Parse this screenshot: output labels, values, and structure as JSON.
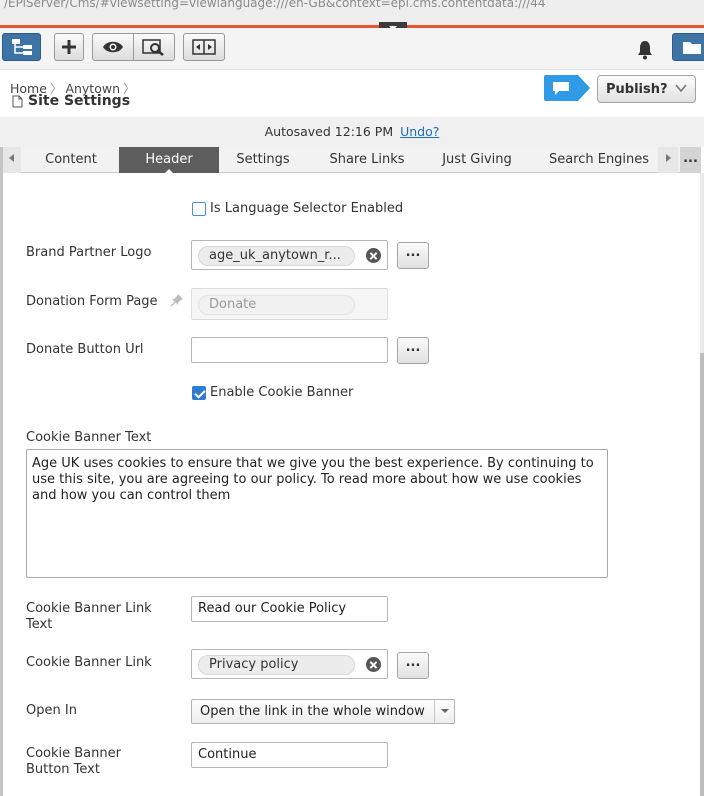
{
  "browser": {
    "url": "/EPiServer/Cms/#viewsetting=viewlanguage:///en-GB&context=epi.cms.contentdata:///44"
  },
  "toolbar": {
    "tree_icon": "page-tree-icon",
    "add_icon": "plus-icon",
    "preview_icon": "eye-icon",
    "view_icon": "view-settings-icon",
    "compare_icon": "compare-icon",
    "notification_icon": "bell-icon",
    "assets_icon": "folder-icon"
  },
  "breadcrumb": {
    "items": [
      "Home",
      "Anytown"
    ]
  },
  "page": {
    "title": "Site Settings"
  },
  "publish": {
    "label": "Publish?"
  },
  "autosave": {
    "text": "Autosaved 12:16 PM",
    "undo": "Undo?"
  },
  "tabs": [
    {
      "label": "Content"
    },
    {
      "label": "Header"
    },
    {
      "label": "Settings"
    },
    {
      "label": "Share Links"
    },
    {
      "label": "Just Giving"
    },
    {
      "label": "Search Engines"
    }
  ],
  "tabs_more": "...",
  "form": {
    "language_selector": {
      "label": "Is Language Selector Enabled",
      "checked": false
    },
    "brand_partner_logo": {
      "label": "Brand Partner Logo",
      "value": "age_uk_anytown_r...",
      "browse": "..."
    },
    "donation_form_page": {
      "label": "Donation Form Page",
      "value": "Donate"
    },
    "donate_button_url": {
      "label": "Donate Button Url",
      "value": "",
      "browse": "..."
    },
    "cookie_banner": {
      "label": "Enable Cookie Banner",
      "checked": true
    },
    "cookie_banner_text": {
      "label": "Cookie Banner Text",
      "value": "Age UK uses cookies to ensure that we give you the best experience. By continuing to use this site, you are agreeing to our policy. To read more about how we use cookies and how you can control them"
    },
    "cookie_link_text": {
      "label_line1": "Cookie Banner Link",
      "label_line2": "Text",
      "value": "Read our Cookie Policy"
    },
    "cookie_link": {
      "label": "Cookie Banner Link",
      "value": "Privacy policy",
      "browse": "..."
    },
    "open_in": {
      "label": "Open In",
      "value": "Open the link in the whole window"
    },
    "cookie_button_text": {
      "label_line1": "Cookie Banner",
      "label_line2": "Button Text",
      "value": "Continue"
    }
  },
  "colors": {
    "accent": "#e8572a",
    "primary": "#3e73a6",
    "tab_active": "#5d5d5d",
    "link": "#1f6fbf",
    "chat": "#2f9be6"
  }
}
